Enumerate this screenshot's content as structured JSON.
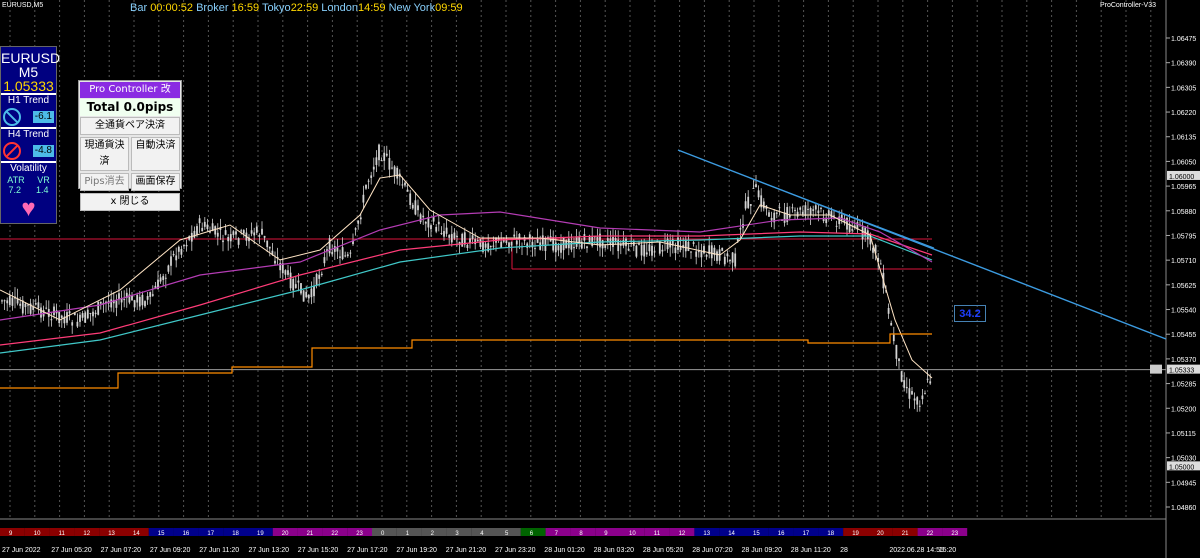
{
  "window": {
    "symbol_title": "EURUSD,M5",
    "indicator_title": "ProController-V33"
  },
  "sessions": [
    {
      "label": "Bar",
      "value": "00:00:52"
    },
    {
      "label": "Broker",
      "value": "16:59"
    },
    {
      "label": "Tokyo",
      "value": "22:59"
    },
    {
      "label": "London",
      "value": "14:59"
    },
    {
      "label": "New York",
      "value": "09:59"
    }
  ],
  "info_panel": {
    "symbol": "EURUSD",
    "timeframe": "M5",
    "price": "1.05333",
    "h1_label": "H1 Trend",
    "h1_value": "-6.1",
    "h4_label": "H4 Trend",
    "h4_value": "-4.8",
    "volatility_label": "Volatility",
    "atr_label": "ATR",
    "vr_label": "VR",
    "atr_value": "7.2",
    "vr_value": "1.4"
  },
  "pro_controller": {
    "title": "Pro Controller 改",
    "total": "Total   0.0pips",
    "close_all": "全通貨ペア決済",
    "close_current": "現通貨決済",
    "auto_close": "自動決済",
    "clear_pips": "Pips消去",
    "save_screen": "画面保存",
    "close_panel": "x 閉じる"
  },
  "marker_box": "34.2",
  "price_axis": {
    "labels": [
      "1.06475",
      "1.06390",
      "1.06305",
      "1.06220",
      "1.06135",
      "1.06050",
      "1.05965",
      "1.05880",
      "1.05795",
      "1.05710",
      "1.05625",
      "1.05540",
      "1.05455",
      "1.05370",
      "1.05285",
      "1.05200",
      "1.05115",
      "1.05030",
      "1.04945",
      "1.04860"
    ],
    "highlight_upper": "1.06000",
    "current_price": "1.05333",
    "highlight_lower": "1.05000"
  },
  "time_axis": {
    "labels": [
      "27 Jun 2022",
      "27 Jun 05:20",
      "27 Jun 07:20",
      "27 Jun 09:20",
      "27 Jun 11:20",
      "27 Jun 13:20",
      "27 Jun 15:20",
      "27 Jun 17:20",
      "27 Jun 19:20",
      "27 Jun 21:20",
      "27 Jun 23:20",
      "28 Jun 01:20",
      "28 Jun 03:20",
      "28 Jun 05:20",
      "28 Jun 07:20",
      "28 Jun 09:20",
      "28 Jun 11:20",
      "28",
      "2022.06.28 14:55",
      "15:20"
    ],
    "hours": [
      "9",
      "10",
      "11",
      "12",
      "13",
      "14",
      "15",
      "16",
      "17",
      "18",
      "19",
      "20",
      "21",
      "22",
      "23",
      "0",
      "1",
      "2",
      "3",
      "4",
      "5",
      "6",
      "7",
      "8",
      "9",
      "10",
      "11",
      "12",
      "13",
      "14",
      "15",
      "16",
      "17",
      "18",
      "19",
      "20",
      "21",
      "22",
      "23"
    ]
  },
  "colors": {
    "background": "#000000",
    "candle": "#d3d3d3",
    "trendline": "#3c9be0",
    "ma_fast": "#ffe4c4",
    "ma_magenta": "#b43cb4",
    "ma_teal": "#40c8c8",
    "ma_pink": "#ff3c78",
    "stop_line": "#ff8c00",
    "box": "#dc143c"
  }
}
